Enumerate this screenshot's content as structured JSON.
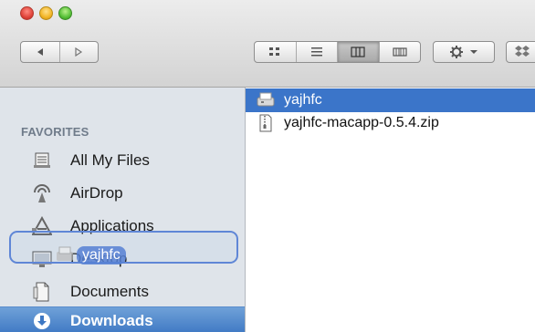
{
  "sidebar": {
    "section_title": "FAVORITES",
    "items": [
      {
        "label": "All My Files",
        "icon": "all-my-files-icon"
      },
      {
        "label": "AirDrop",
        "icon": "airdrop-icon"
      },
      {
        "label": "Applications",
        "icon": "applications-icon"
      },
      {
        "label": "Desktop",
        "icon": "desktop-icon"
      },
      {
        "label": "Documents",
        "icon": "documents-icon"
      },
      {
        "label": "Downloads",
        "icon": "downloads-icon"
      }
    ]
  },
  "drag": {
    "label": "yajhfc"
  },
  "files": [
    {
      "name": "yajhfc",
      "icon": "fax-app-icon"
    },
    {
      "name": "yajhfc-macapp-0.5.4.zip",
      "icon": "zip-file-icon"
    }
  ],
  "colors": {
    "selection": "#3b75c9",
    "sidebar_bg": "#dfe4ea",
    "drop_ring": "#5f86d6"
  }
}
